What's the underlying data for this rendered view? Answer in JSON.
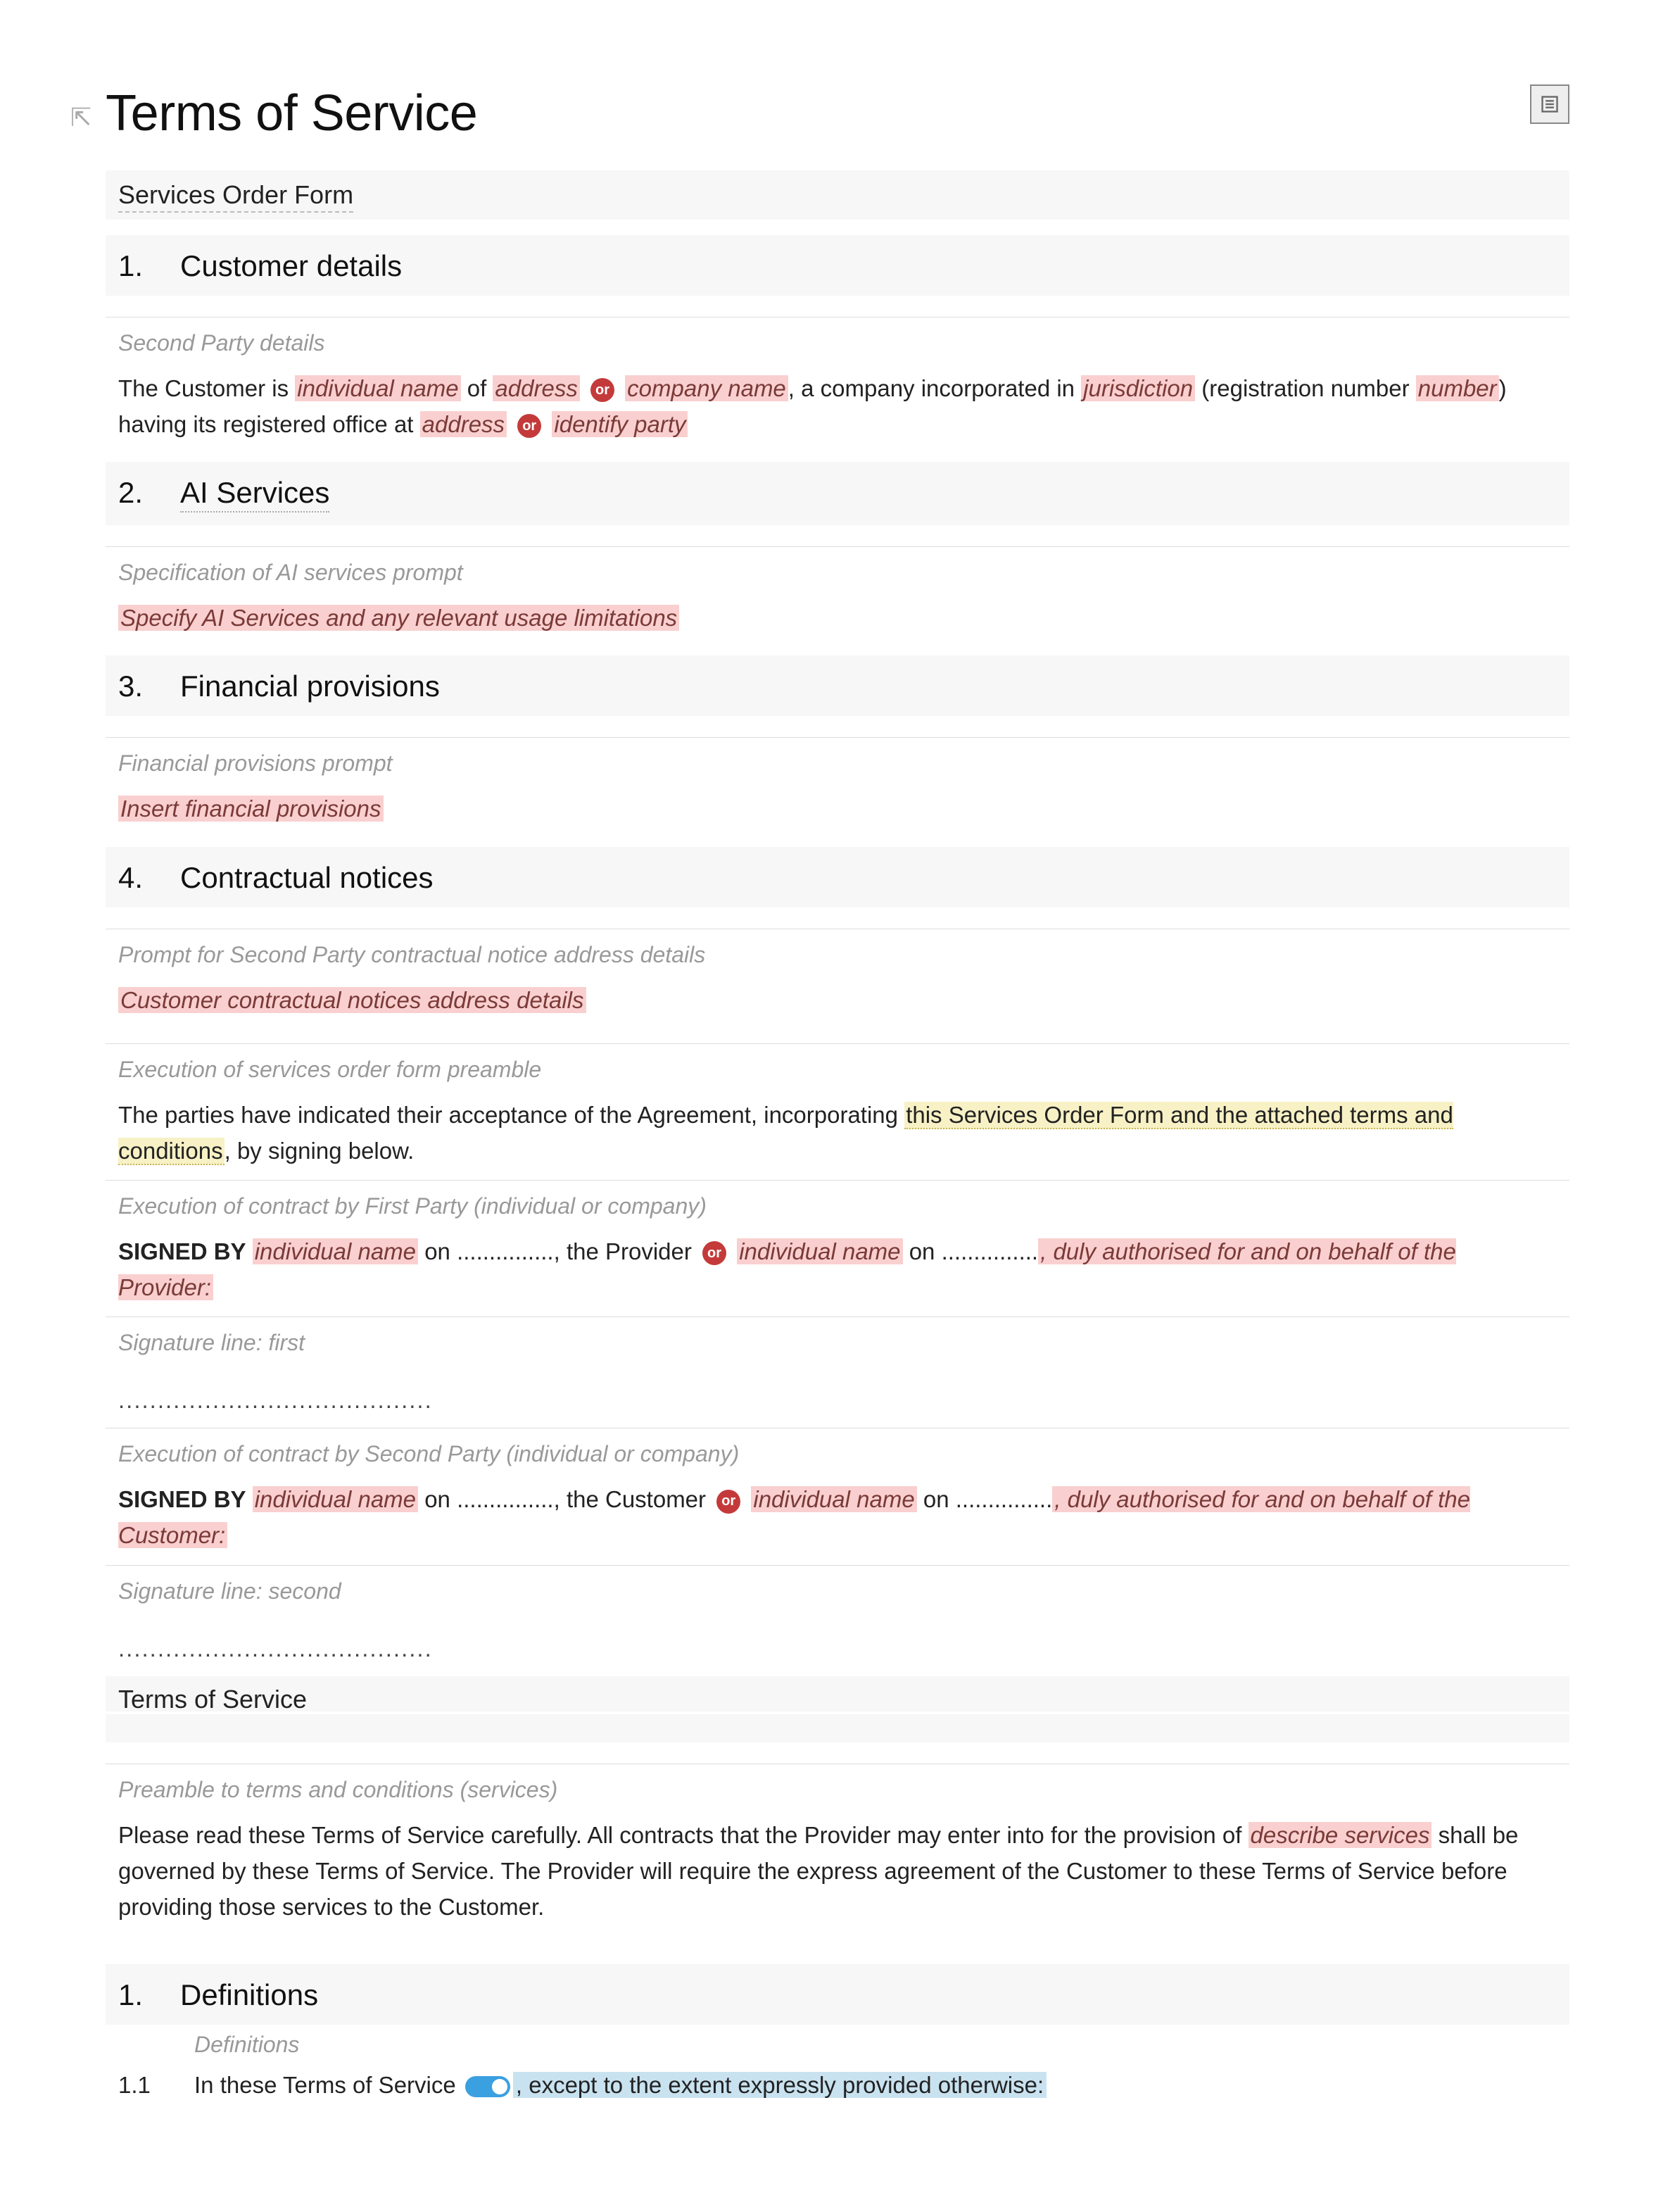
{
  "header": {
    "title": "Terms of Service"
  },
  "form": {
    "title": "Services Order Form"
  },
  "sections": {
    "s1": {
      "num": "1.",
      "title": "Customer details"
    },
    "s2": {
      "num": "2.",
      "title": "AI Services"
    },
    "s3": {
      "num": "3.",
      "title": "Financial provisions"
    },
    "s4": {
      "num": "4.",
      "title": "Contractual notices"
    },
    "def": {
      "num": "1.",
      "title": "Definitions"
    }
  },
  "prompts": {
    "second_party": "Second Party details",
    "ai_spec": "Specification of AI services prompt",
    "fin": "Financial provisions prompt",
    "notice": "Prompt for Second Party contractual notice address details",
    "exec_preamble": "Execution of services order form preamble",
    "exec_first": "Execution of contract by First Party (individual or company)",
    "sig_first": "Signature line: first",
    "exec_second": "Execution of contract by Second Party (individual or company)",
    "sig_second": "Signature line: second",
    "preamble_tc": "Preamble to terms and conditions (services)",
    "definitions_label": "Definitions"
  },
  "placeholders": {
    "individual_name": "individual name",
    "address": "address",
    "company_name": "company name",
    "jurisdiction": "jurisdiction",
    "number": "number",
    "identify_party": "identify party",
    "describe_services": "describe services",
    "or": "or"
  },
  "body": {
    "customer_1a": "The Customer is ",
    "customer_1b": " of ",
    "customer_1c": ", a company incorporated in ",
    "customer_1d": " (registration number ",
    "customer_1e": ") having its registered office at ",
    "ai_body": "Specify AI Services and any relevant usage limitations",
    "fin_body": "Insert financial provisions",
    "notice_body": "Customer contractual notices address details",
    "exec_preamble_a": "The parties have indicated their acceptance of the Agreement, incorporating ",
    "exec_preamble_b": "this Services Order Form and the attached terms and conditions",
    "exec_preamble_c": ", by signing below.",
    "signed_by": "SIGNED BY",
    "on_dots": " on ...............",
    "the_provider": ", the Provider ",
    "the_customer": ", the Customer ",
    "duly_provider": ", duly authorised for and on behalf of the Provider:",
    "duly_customer": ", duly authorised for and on behalf of the Customer:",
    "sig_dots": "........................................",
    "tos_subtitle": "Terms of Service",
    "preamble_a": "Please read these Terms of Service carefully. All contracts that the Provider may enter into for the provision of ",
    "preamble_b": " shall be governed by these Terms of Service. The Provider will require the express agreement of the Customer to these Terms of Service before providing those services to the Customer.",
    "def_11_num": "1.1",
    "def_11_a": "In these Terms of Service ",
    "def_11_b": ", except to the extent expressly provided otherwise:"
  }
}
